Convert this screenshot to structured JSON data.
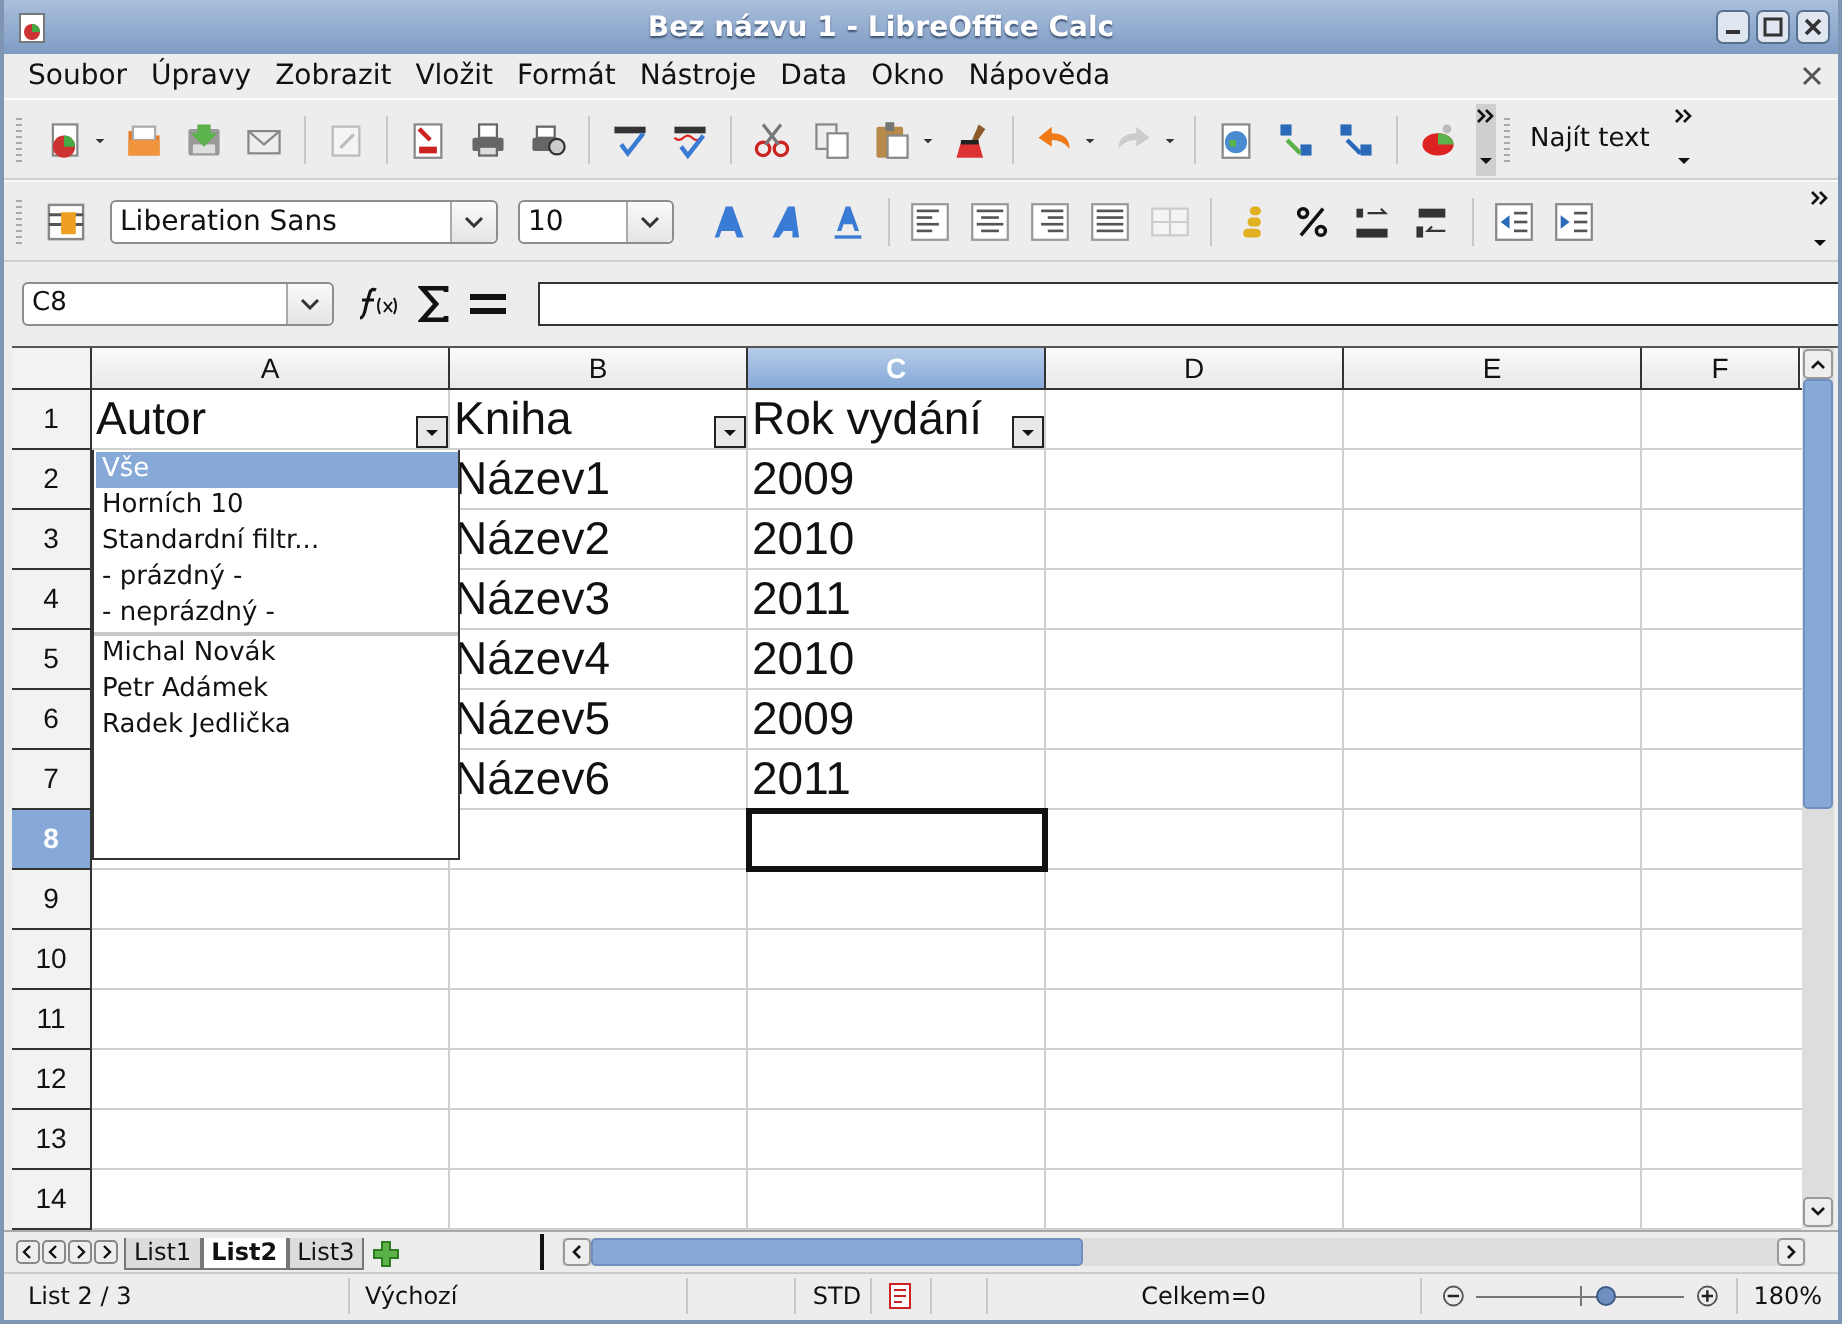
{
  "window": {
    "title": "Bez názvu 1 - LibreOffice Calc"
  },
  "menu": [
    "Soubor",
    "Úpravy",
    "Zobrazit",
    "Vložit",
    "Formát",
    "Nástroje",
    "Data",
    "Okno",
    "Nápověda"
  ],
  "toolbar": {
    "find_label": "Najít text"
  },
  "formatting": {
    "font": "Liberation Sans",
    "size": "10"
  },
  "formula_bar": {
    "name_box": "C8"
  },
  "columns": [
    {
      "label": "A",
      "selected": false
    },
    {
      "label": "B",
      "selected": false
    },
    {
      "label": "C",
      "selected": true
    },
    {
      "label": "D",
      "selected": false
    },
    {
      "label": "E",
      "selected": false
    },
    {
      "label": "F",
      "selected": false
    }
  ],
  "rows": [
    {
      "header": "1",
      "selected": false,
      "cells": [
        {
          "kind": "filter",
          "text": "Autor"
        },
        {
          "kind": "filter",
          "text": "Kniha"
        },
        {
          "kind": "filter",
          "text": "Rok vydání"
        }
      ]
    },
    {
      "header": "2",
      "selected": false,
      "cells": [
        {
          "kind": "blank"
        },
        {
          "kind": "text",
          "text": "Název1"
        },
        {
          "kind": "text",
          "text": "2009"
        }
      ]
    },
    {
      "header": "3",
      "selected": false,
      "cells": [
        {
          "kind": "blank"
        },
        {
          "kind": "text",
          "text": "Název2"
        },
        {
          "kind": "text",
          "text": "2010"
        }
      ]
    },
    {
      "header": "4",
      "selected": false,
      "cells": [
        {
          "kind": "blank"
        },
        {
          "kind": "text",
          "text": "Název3"
        },
        {
          "kind": "text",
          "text": "2011"
        }
      ]
    },
    {
      "header": "5",
      "selected": false,
      "cells": [
        {
          "kind": "blank"
        },
        {
          "kind": "text",
          "text": "Název4"
        },
        {
          "kind": "text",
          "text": "2010"
        }
      ]
    },
    {
      "header": "6",
      "selected": false,
      "cells": [
        {
          "kind": "blank"
        },
        {
          "kind": "text",
          "text": "Název5"
        },
        {
          "kind": "text",
          "text": "2009"
        }
      ]
    },
    {
      "header": "7",
      "selected": false,
      "cells": [
        {
          "kind": "blank"
        },
        {
          "kind": "text",
          "text": "Název6"
        },
        {
          "kind": "text",
          "text": "2011"
        }
      ]
    },
    {
      "header": "8",
      "selected": true,
      "cells": [
        {
          "kind": "blank"
        },
        {
          "kind": "blank"
        },
        {
          "kind": "cursor"
        }
      ]
    },
    {
      "header": "9",
      "selected": false
    },
    {
      "header": "10",
      "selected": false
    },
    {
      "header": "11",
      "selected": false
    },
    {
      "header": "12",
      "selected": false
    },
    {
      "header": "13",
      "selected": false
    },
    {
      "header": "14",
      "selected": false
    }
  ],
  "filter_popup": {
    "commands": [
      {
        "label": "Vše",
        "selected": true
      },
      {
        "label": "Horních 10",
        "selected": false
      },
      {
        "label": "Standardní filtr...",
        "selected": false
      },
      {
        "label": "- prázdný -",
        "selected": false
      },
      {
        "label": "- neprázdný -",
        "selected": false
      }
    ],
    "values": [
      {
        "label": "Michal Novák",
        "selected": false
      },
      {
        "label": "Petr Adámek",
        "selected": false
      },
      {
        "label": "Radek Jedlička",
        "selected": false
      }
    ]
  },
  "sheet_tabs": [
    {
      "label": "List1",
      "selected": false
    },
    {
      "label": "List2",
      "selected": true
    },
    {
      "label": "List3",
      "selected": false
    }
  ],
  "status_bar": {
    "sheet": "List 2 / 3",
    "style": "Výchozí",
    "mode": "STD",
    "sum": "Celkem=0",
    "zoom": {
      "level": 0.62,
      "reading": "180%"
    }
  }
}
